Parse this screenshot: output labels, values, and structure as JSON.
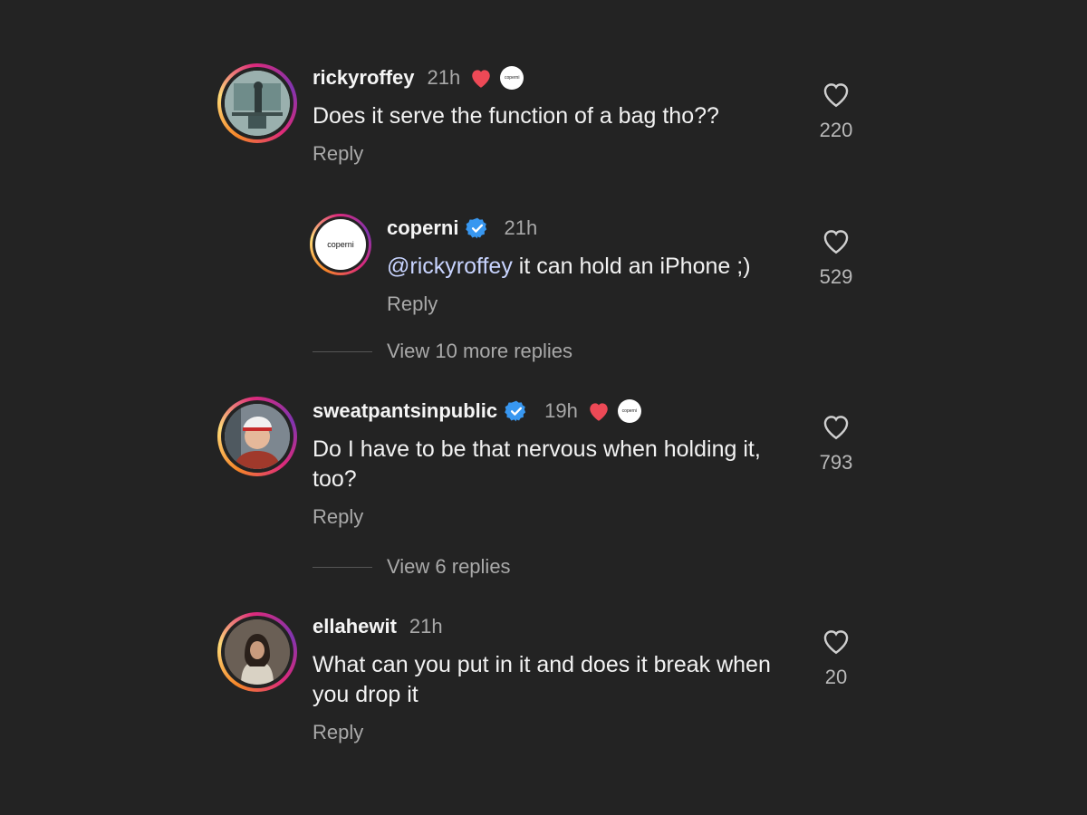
{
  "comments": [
    {
      "username": "rickyroffey",
      "time": "21h",
      "text": "Does it serve the function of a bag tho??",
      "reply_label": "Reply",
      "likes": "220",
      "liked_by_author": true,
      "verified": false
    },
    {
      "username": "coperni",
      "time": "21h",
      "mention": "@rickyroffey",
      "text": " it can hold an iPhone ;)",
      "reply_label": "Reply",
      "likes": "529",
      "verified": true,
      "avatar_text": "coperni"
    },
    {
      "username": "sweatpantsinpublic",
      "time": "19h",
      "text": "Do I have to be that nervous when holding it, too?",
      "reply_label": "Reply",
      "likes": "793",
      "liked_by_author": true,
      "verified": true
    },
    {
      "username": "ellahewit",
      "time": "21h",
      "text": "What can you put in it and does it break when you drop it",
      "reply_label": "Reply",
      "likes": "20",
      "verified": false
    }
  ],
  "view_more": [
    {
      "label": "View 10 more replies"
    },
    {
      "label": "View 6 replies"
    }
  ],
  "colors": {
    "background": "#232323",
    "like_red": "#ed4956",
    "verified_blue": "#3897f0",
    "secondary_text": "#a9a9a9"
  },
  "icons": {
    "heart": "heart-outline-icon",
    "liked_by_author": "heart-filled-icon",
    "verified": "verified-badge-icon"
  }
}
